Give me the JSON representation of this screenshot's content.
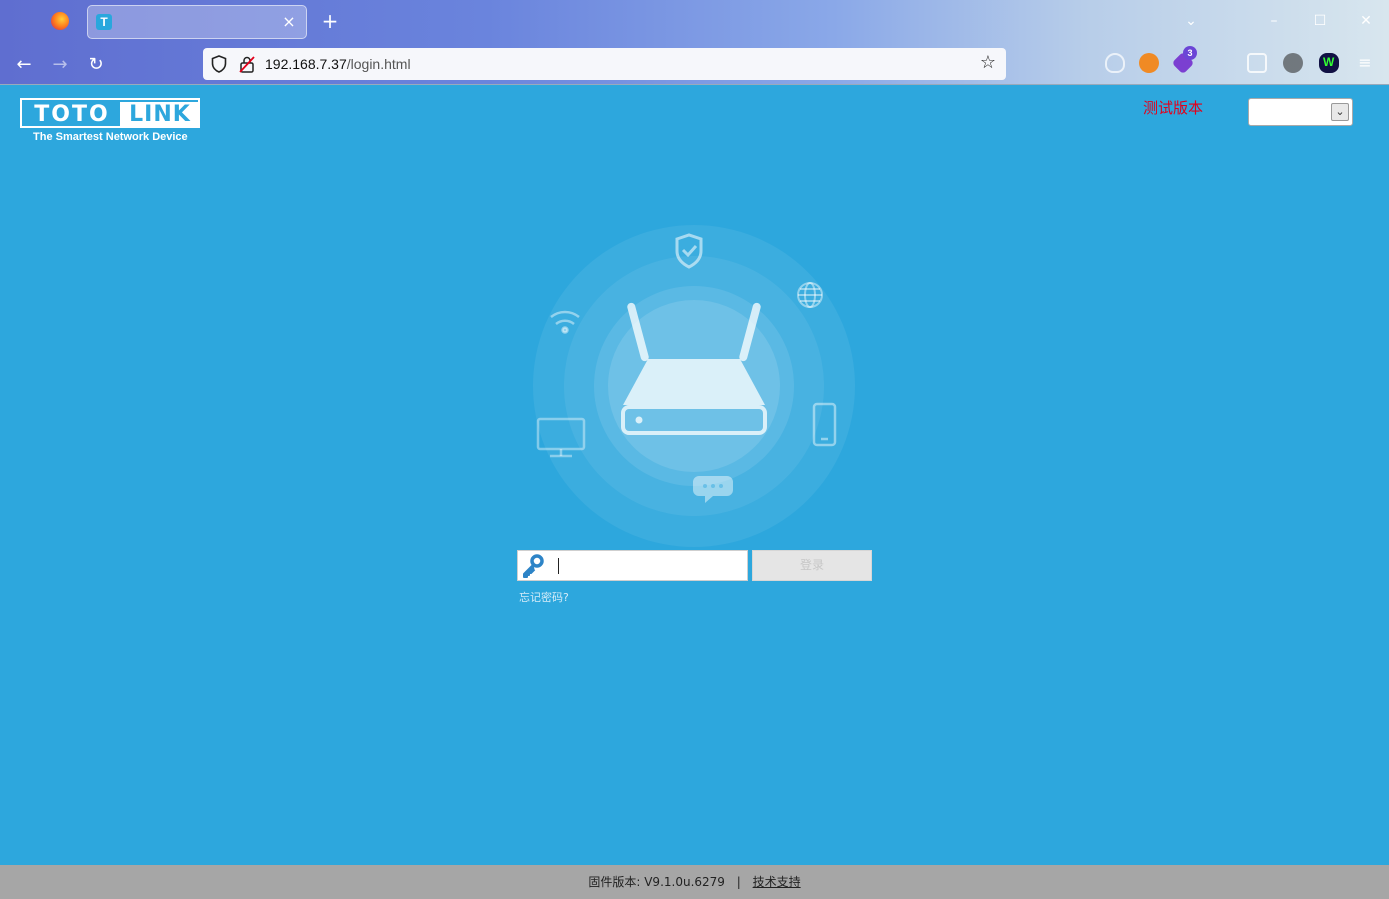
{
  "browser": {
    "tab": {
      "title": "",
      "favicon_letter": "T"
    },
    "new_tab_label": "+",
    "nav": {
      "back": "←",
      "forward": "→",
      "reload": "↻"
    },
    "url": {
      "host": "192.168.7.37",
      "path": "/login.html"
    },
    "bookmark_icon": "star-icon",
    "extension_badge": "3",
    "window_controls": {
      "list": "⌄",
      "minimize": "–",
      "maximize": "☐",
      "close": "✕"
    },
    "menu_icon": "≡"
  },
  "page": {
    "logo": {
      "part1": "TOTO",
      "part2": "LINK",
      "tagline": "The Smartest Network Device"
    },
    "test_version_label": "测试版本",
    "language_select": {
      "selected": ""
    },
    "login": {
      "password_value": "",
      "button_label": "登录",
      "forgot_link": "忘记密码?"
    },
    "footer": {
      "firmware_label": "固件版本:",
      "firmware_version": "V9.1.0u.6279",
      "separator": "|",
      "support_link": "技术支持"
    },
    "colors": {
      "background": "#2da7dd",
      "test_label": "#e3001b",
      "footer_bg": "#a6a6a6"
    }
  }
}
